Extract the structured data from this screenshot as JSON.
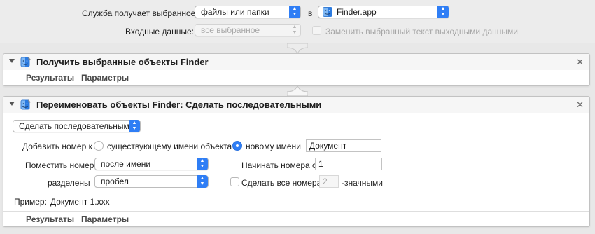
{
  "header": {
    "service_receives_label": "Служба получает выбранное:",
    "input_type_value": "файлы или папки",
    "in_label": "в",
    "app_value": "Finder.app",
    "input_data_label": "Входные данные:",
    "input_data_value": "все выбранное",
    "replace_label": "Заменить выбранный текст выходными данными"
  },
  "action1": {
    "title": "Получить выбранные объекты Finder",
    "tabs": [
      "Результаты",
      "Параметры"
    ]
  },
  "action2": {
    "title": "Переименовать объекты Finder: Сделать последовательными",
    "mode_value": "Сделать последовательными",
    "add_number_label": "Добавить номер к",
    "existing_name_label": "существующему имени объекта",
    "new_name_label": "новому имени",
    "new_name_value": "Документ",
    "place_number_label": "Поместить номер",
    "place_value": "после имени",
    "start_numbers_label": "Начинать номера с",
    "start_value": "1",
    "separated_label": "разделены",
    "separator_value": "пробел",
    "all_numbers_label": "Сделать все номера",
    "digits_value": "2",
    "digits_suffix": "-значными",
    "example_label": "Пример:",
    "example_value": "Документ 1.xxx",
    "tabs": [
      "Результаты",
      "Параметры"
    ]
  },
  "icons": {
    "finder": "finder-icon",
    "close": "close-icon",
    "disclosure": "disclosure-triangle-icon"
  },
  "colors": {
    "accent": "#2f7ef5",
    "background": "#e8e8e8"
  }
}
